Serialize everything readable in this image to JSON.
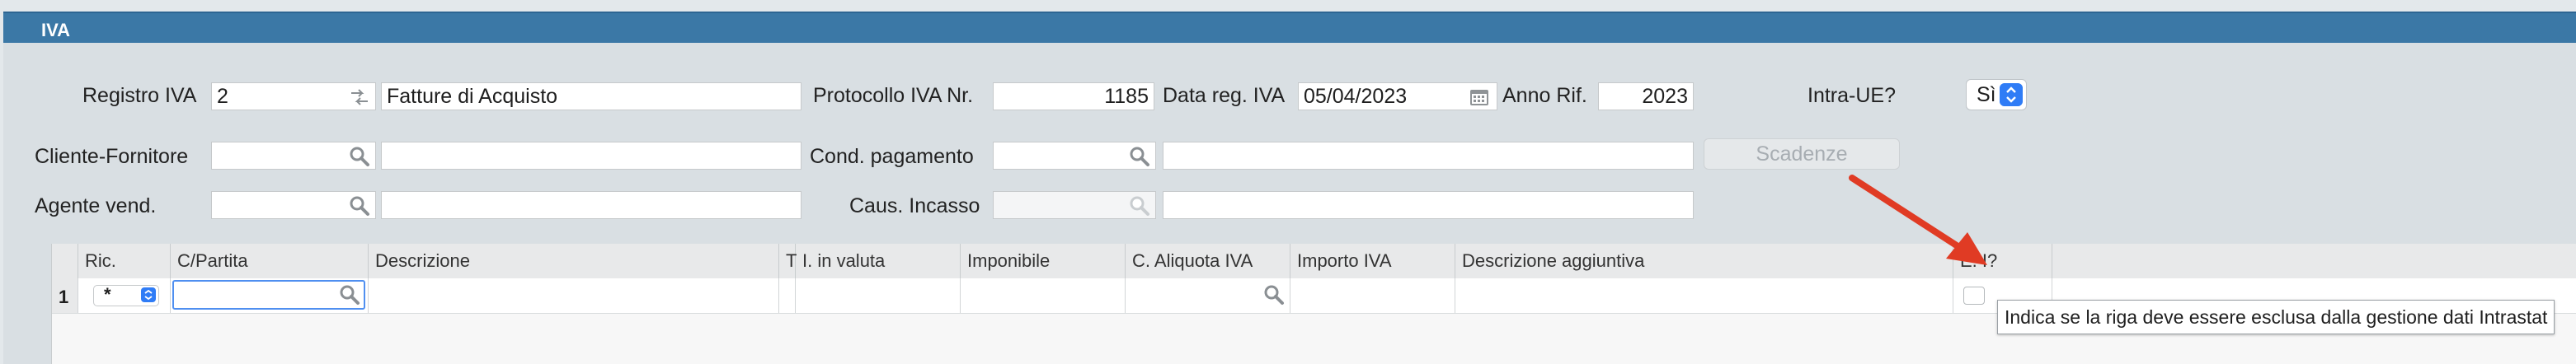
{
  "window": {
    "title": "IVA"
  },
  "colors": {
    "titlebar": "#3b78a6",
    "accent": "#2f7cf6",
    "arrow": "#e03b24"
  },
  "form": {
    "registro": {
      "label": "Registro IVA",
      "value": "2",
      "desc": "Fatture di Acquisto"
    },
    "protocollo": {
      "label": "Protocollo IVA Nr.",
      "value": "1185"
    },
    "data_reg": {
      "label": "Data reg. IVA",
      "value": "05/04/2023"
    },
    "anno_rif": {
      "label": "Anno Rif.",
      "value": "2023"
    },
    "intra_ue": {
      "label": "Intra-UE?",
      "value": "Sì"
    },
    "cliente": {
      "label": "Cliente-Fornitore",
      "value": "",
      "desc": ""
    },
    "cond_pagamento": {
      "label": "Cond. pagamento",
      "value": "",
      "desc": ""
    },
    "scadenze_button": "Scadenze",
    "agente": {
      "label": "Agente vend.",
      "value": "",
      "desc": ""
    },
    "caus_incasso": {
      "label": "Caus. Incasso",
      "value": "",
      "desc": ""
    }
  },
  "grid": {
    "columns": [
      "Ric.",
      "C/Partita",
      "Descrizione",
      "T",
      "I. in valuta",
      "Imponibile",
      "C. Aliquota IVA",
      "Importo IVA",
      "Descrizione aggiuntiva",
      "E. I?"
    ],
    "rows": [
      {
        "num": "1",
        "ric": "*"
      }
    ]
  },
  "tooltip": "Indica se la riga deve essere esclusa dalla gestione dati Intrastat"
}
